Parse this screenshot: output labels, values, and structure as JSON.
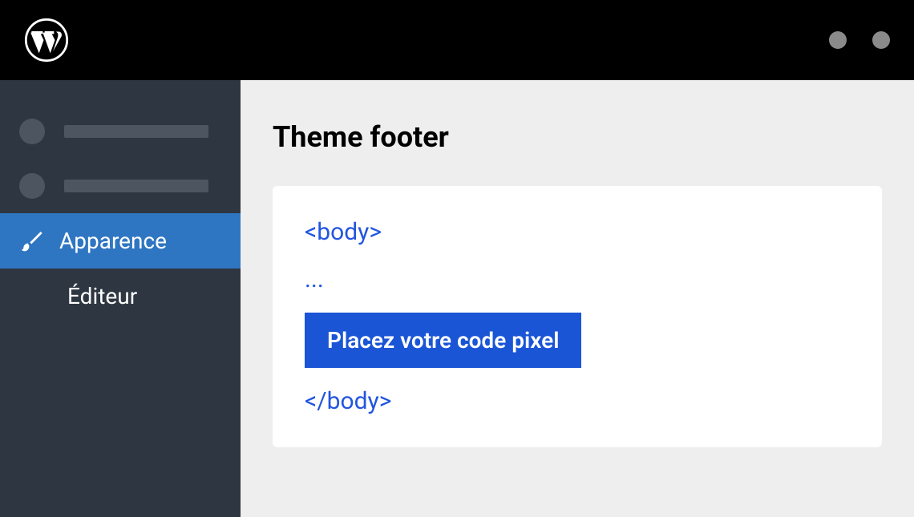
{
  "sidebar": {
    "items": [
      {
        "label": "Apparence"
      },
      {
        "label": "Éditeur"
      }
    ]
  },
  "content": {
    "title": "Theme footer",
    "code": {
      "open_tag": "<body>",
      "ellipsis": "...",
      "highlight": "Placez votre code pixel",
      "close_tag": "</body>"
    }
  }
}
